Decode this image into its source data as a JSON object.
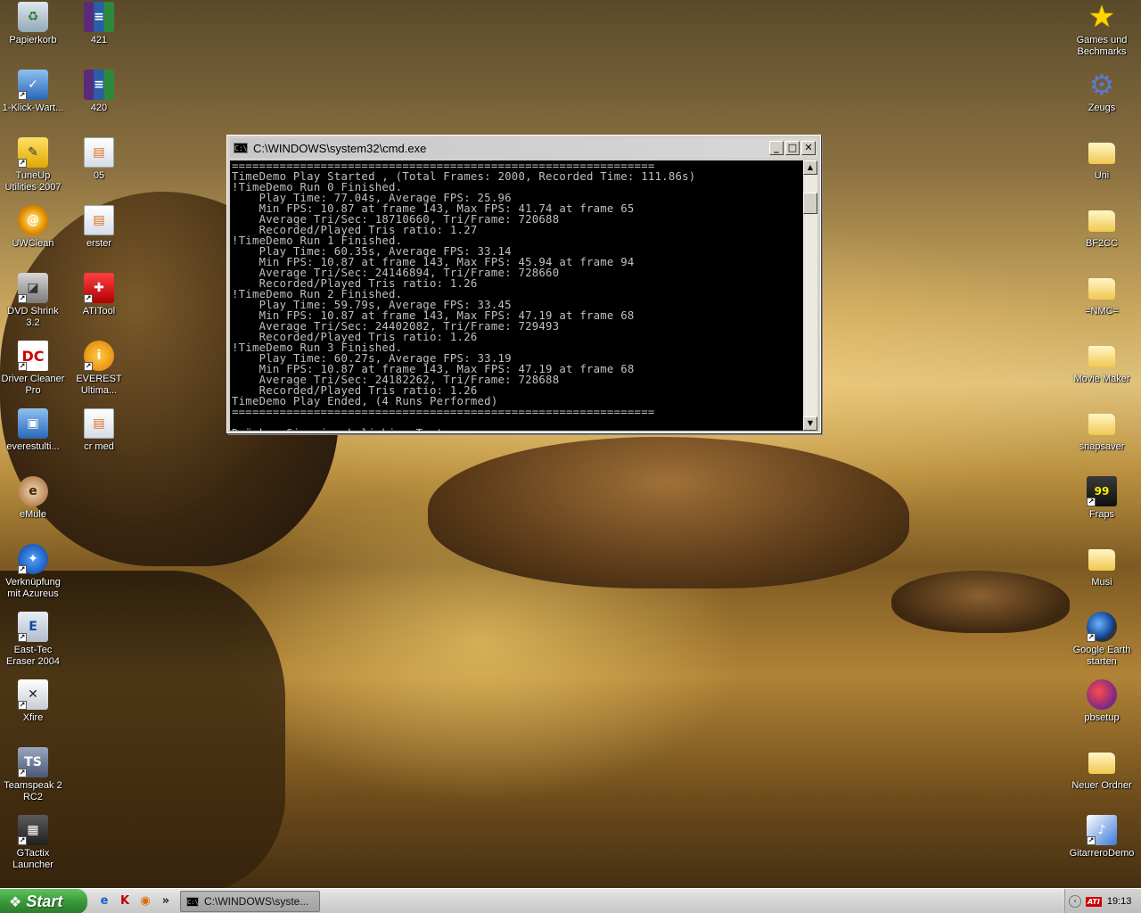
{
  "desktop": {
    "left_icons": [
      {
        "label": "Papierkorb",
        "icon": "recycle-bin-icon",
        "glyph": "♻"
      },
      {
        "label": "1-Klick-Wart...",
        "icon": "tuneup-oneclick-icon",
        "glyph": "✓"
      },
      {
        "label": "TuneUp Utilities 2007",
        "icon": "tuneup-icon",
        "glyph": "✎"
      },
      {
        "label": "UWClean",
        "icon": "uwclean-icon",
        "glyph": "@"
      },
      {
        "label": "DVD Shrink 3.2",
        "icon": "dvd-shrink-icon",
        "glyph": "◪"
      },
      {
        "label": "Driver Cleaner Pro",
        "icon": "driver-cleaner-icon",
        "glyph": "DC"
      },
      {
        "label": "everestulti...",
        "icon": "everest-installer-icon",
        "glyph": "▣"
      },
      {
        "label": "eMule",
        "icon": "emule-icon",
        "glyph": "e"
      },
      {
        "label": "Verknüpfung mit Azureus",
        "icon": "azureus-icon",
        "glyph": "✦"
      },
      {
        "label": "East-Tec Eraser 2004",
        "icon": "east-tec-eraser-icon",
        "glyph": "E"
      },
      {
        "label": "Xfire",
        "icon": "xfire-icon",
        "glyph": "✕"
      },
      {
        "label": "Teamspeak 2 RC2",
        "icon": "teamspeak-icon",
        "glyph": "TS"
      },
      {
        "label": "GTactix Launcher",
        "icon": "gtactix-icon",
        "glyph": "▦"
      }
    ],
    "second_column_icons": [
      {
        "label": "421",
        "icon": "winrar-archive-icon",
        "glyph": "≡"
      },
      {
        "label": "420",
        "icon": "winrar-archive-icon",
        "glyph": "≡"
      },
      {
        "label": "05",
        "icon": "document-icon",
        "glyph": "▤"
      },
      {
        "label": "erster",
        "icon": "document-icon",
        "glyph": "▤"
      },
      {
        "label": "ATITool",
        "icon": "atitool-icon",
        "glyph": "✚"
      },
      {
        "label": "EVEREST Ultima...",
        "icon": "everest-icon",
        "glyph": "i"
      },
      {
        "label": "cr med",
        "icon": "document-icon",
        "glyph": "▤"
      }
    ],
    "right_icons": [
      {
        "label": "Games und Bechmarks",
        "icon": "star-icon",
        "glyph": "★"
      },
      {
        "label": "Zeugs",
        "icon": "gear-icon",
        "glyph": "⚙"
      },
      {
        "label": "Uni",
        "icon": "folder-icon",
        "glyph": ""
      },
      {
        "label": "BF2CC",
        "icon": "folder-icon",
        "glyph": ""
      },
      {
        "label": "=NMC=",
        "icon": "folder-icon",
        "glyph": ""
      },
      {
        "label": "Movie Maker",
        "icon": "folder-icon",
        "glyph": ""
      },
      {
        "label": "snapsaver",
        "icon": "folder-icon",
        "glyph": ""
      },
      {
        "label": "Fraps",
        "icon": "fraps-icon",
        "glyph": "99"
      },
      {
        "label": "Musi",
        "icon": "folder-icon",
        "glyph": ""
      },
      {
        "label": "Google Earth starten",
        "icon": "google-earth-icon",
        "glyph": ""
      },
      {
        "label": "pbsetup",
        "icon": "punkbuster-icon",
        "glyph": ""
      },
      {
        "label": "Neuer Ordner",
        "icon": "folder-icon",
        "glyph": ""
      },
      {
        "label": "GitarreroDemo",
        "icon": "gitarrero-icon",
        "glyph": "♪"
      }
    ]
  },
  "cmd_window": {
    "title": "C:\\WINDOWS\\system32\\cmd.exe",
    "icon_text": "C:\\",
    "minimize_glyph": "_",
    "maximize_glyph": "□",
    "close_glyph": "✕",
    "lines": [
      "==============================================================",
      "TimeDemo Play Started , (Total Frames: 2000, Recorded Time: 111.86s)",
      "!TimeDemo Run 0 Finished.",
      "    Play Time: 77.04s, Average FPS: 25.96",
      "    Min FPS: 10.87 at frame 143, Max FPS: 41.74 at frame 65",
      "    Average Tri/Sec: 18710660, Tri/Frame: 720688",
      "    Recorded/Played Tris ratio: 1.27",
      "!TimeDemo Run 1 Finished.",
      "    Play Time: 60.35s, Average FPS: 33.14",
      "    Min FPS: 10.87 at frame 143, Max FPS: 45.94 at frame 94",
      "    Average Tri/Sec: 24146894, Tri/Frame: 728660",
      "    Recorded/Played Tris ratio: 1.26",
      "!TimeDemo Run 2 Finished.",
      "    Play Time: 59.79s, Average FPS: 33.45",
      "    Min FPS: 10.87 at frame 143, Max FPS: 47.19 at frame 68",
      "    Average Tri/Sec: 24402082, Tri/Frame: 729493",
      "    Recorded/Played Tris ratio: 1.26",
      "!TimeDemo Run 3 Finished.",
      "    Play Time: 60.27s, Average FPS: 33.19",
      "    Min FPS: 10.87 at frame 143, Max FPS: 47.19 at frame 68",
      "    Average Tri/Sec: 24182262, Tri/Frame: 728688",
      "    Recorded/Played Tris ratio: 1.26",
      "TimeDemo Play Ended, (4 Runs Performed)",
      "==============================================================",
      "",
      "Drücken Sie eine beliebige Taste . . ."
    ],
    "scroll_up_glyph": "▲",
    "scroll_down_glyph": "▼"
  },
  "taskbar": {
    "start_label": "Start",
    "start_logo": "❖",
    "quick_launch": [
      {
        "name": "internet-explorer-icon",
        "glyph": "e",
        "color": "#1a5fd0"
      },
      {
        "name": "kaspersky-icon",
        "glyph": "K",
        "color": "#c00000"
      },
      {
        "name": "firefox-icon",
        "glyph": "◉",
        "color": "#e06a00"
      },
      {
        "name": "more-chevron-icon",
        "glyph": "»",
        "color": "#222222"
      }
    ],
    "task_button_label": "C:\\WINDOWS\\syste...",
    "task_icon_text": "C:\\",
    "tray_arrow": "‹",
    "tray_ati_label": "ATI",
    "clock": "19:13"
  }
}
